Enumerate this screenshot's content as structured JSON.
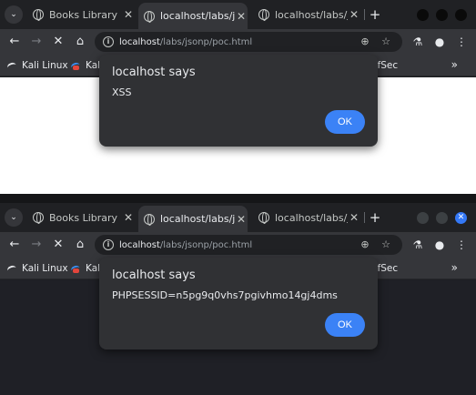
{
  "windows": [
    {
      "tabs": [
        {
          "title": "Books Library",
          "icon": "globe-icon",
          "active": false
        },
        {
          "title": "localhost/labs/js",
          "icon": "globe-icon",
          "active": true
        },
        {
          "title": "localhost/labs/js",
          "icon": "globe-icon",
          "active": false
        }
      ],
      "tab_menu_icon": "⌄",
      "new_tab_label": "+",
      "address": {
        "host": "localhost",
        "path": "/labs/jsonp/poc.html"
      },
      "bookmarks": [
        "Kali Linux",
        "Kali",
        "ffSec"
      ],
      "bookmarks_more": "»",
      "dialog": {
        "title": "localhost says",
        "message": "XSS",
        "ok_label": "OK"
      }
    },
    {
      "tabs": [
        {
          "title": "Books Library",
          "icon": "globe-icon",
          "active": false
        },
        {
          "title": "localhost/labs/js",
          "icon": "loading-icon",
          "active": true
        },
        {
          "title": "localhost/labs/js",
          "icon": "globe-icon",
          "active": false
        }
      ],
      "tab_menu_icon": "⌄",
      "new_tab_label": "+",
      "address": {
        "host": "localhost",
        "path": "/labs/jsonp/poc.html"
      },
      "bookmarks": [
        "Kali Linux",
        "Kali",
        "ffSec"
      ],
      "bookmarks_more": "»",
      "dialog": {
        "title": "localhost says",
        "message": "PHPSESSID=n5pg9q0vhs7pgivhmo14gj4dms",
        "ok_label": "OK"
      }
    }
  ],
  "icons": {
    "back": "←",
    "forward": "→",
    "stop": "✕",
    "home": "⌂",
    "info": "i",
    "zoom": "⊕",
    "star": "☆",
    "lab": "⚗",
    "profile": "●",
    "menu": "⋮",
    "close_tab": "✕"
  },
  "colors": {
    "accent": "#3b82f6",
    "dialog_bg": "#303134",
    "toolbar_bg": "#35363a"
  }
}
